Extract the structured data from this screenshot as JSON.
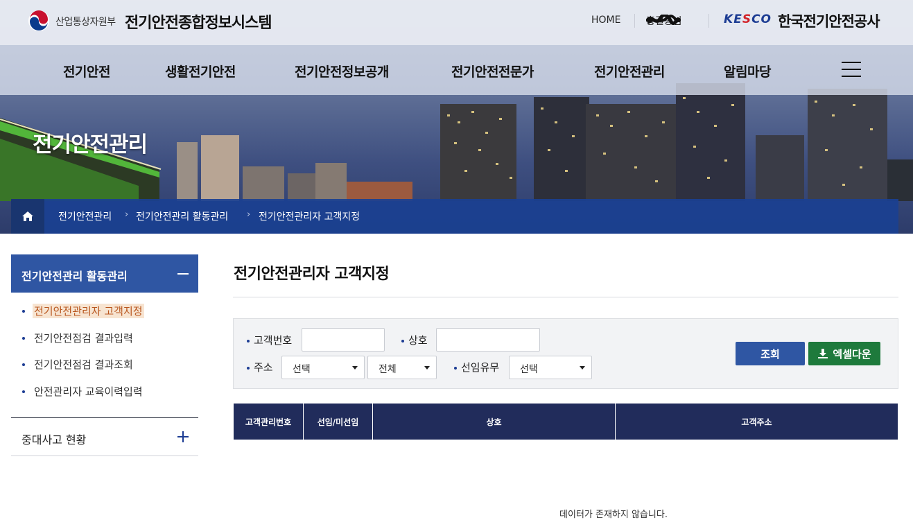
{
  "header": {
    "gov_name": "산업통상자원부",
    "site_title": "전기안전종합정보시스템",
    "home_link": "HOME",
    "user_name": "홍길동",
    "user_suffix": "님",
    "org_logo_text": "KESCO",
    "org_name": "한국전기안전공사"
  },
  "nav": {
    "items": [
      "전기안전",
      "생활전기안전",
      "전기안전정보공개",
      "전기안전전문가",
      "전기안전관리",
      "알림마당"
    ]
  },
  "banner": {
    "title": "전기안전관리"
  },
  "breadcrumb": {
    "items": [
      "전기안전관리",
      "전기안전관리 활동관리",
      "전기안전관리자 고객지정"
    ]
  },
  "sidebar": {
    "open_section": "전기안전관리 활동관리",
    "sub_items": [
      "전기안전관리자 고객지정",
      "전기안전점검 결과입력",
      "전기안전점검 결과조회",
      "안전관리자 교육이력입력"
    ],
    "active_index": 0,
    "closed_section": "중대사고 현황"
  },
  "content": {
    "page_title": "전기안전관리자 고객지정"
  },
  "search": {
    "customer_no_label": "고객번호",
    "customer_no_value": "",
    "company_label": "상호",
    "company_value": "",
    "address_label": "주소",
    "address_select_1": "선택",
    "address_select_2": "전체",
    "appointed_label": "선임유무",
    "appointed_select": "선택",
    "search_button": "조회",
    "excel_button": "엑셀다운"
  },
  "table": {
    "columns": [
      "고객관리번호",
      "선임/미선임",
      "상호",
      "고객주소"
    ],
    "rows": [],
    "empty_message": "데이터가 존재하지 않습니다."
  },
  "colors": {
    "primary_blue": "#2f56a3",
    "table_header": "#212c5b",
    "excel_green": "#1e7a3c",
    "active_text": "#b8551d",
    "active_bg": "#f7e4d1"
  }
}
